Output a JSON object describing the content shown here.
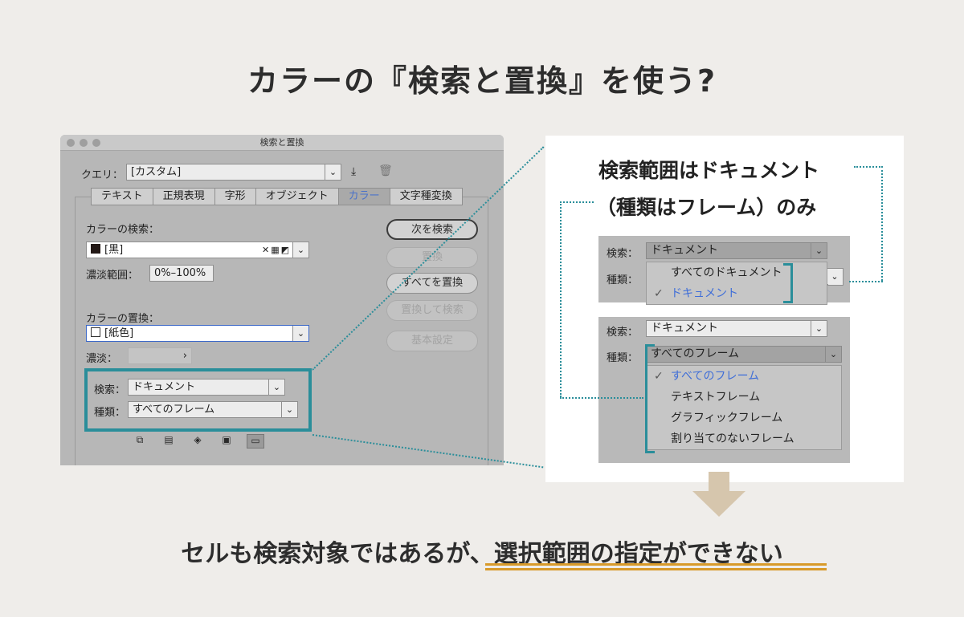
{
  "title": "カラーの『検索と置換』を使う?",
  "dialog": {
    "window_title": "検索と置換",
    "query_label": "クエリ：",
    "query_value": "[カスタム]",
    "tabs": [
      "テキスト",
      "正規表現",
      "字形",
      "オブジェクト",
      "カラー",
      "文字種変換"
    ],
    "active_tab": "カラー",
    "find_color_label": "カラーの検索：",
    "find_color_value": "[黒]",
    "tint_range_label": "濃淡範囲：",
    "tint_range_value": "0%–100%",
    "replace_color_label": "カラーの置換：",
    "replace_color_value": "[紙色]",
    "tint_label": "濃淡：",
    "search_label": "検索：",
    "search_value": "ドキュメント",
    "type_label": "種類：",
    "type_value": "すべてのフレーム",
    "buttons": {
      "find_next": "次を検索",
      "replace": "置換",
      "replace_all": "すべてを置換",
      "replace_find": "置換して検索",
      "basic": "基本設定"
    }
  },
  "panel": {
    "heading_line1": "検索範囲はドキュメント",
    "heading_line2": "（種類はフレーム）のみ",
    "search_label": "検索：",
    "search_value": "ドキュメント",
    "type_label": "種類：",
    "scope_menu": [
      "すべてのドキュメント",
      "ドキュメント"
    ],
    "scope_checked": "ドキュメント",
    "type_value": "すべてのフレーム",
    "type_menu": [
      "すべてのフレーム",
      "テキストフレーム",
      "グラフィックフレーム",
      "割り当てのないフレーム"
    ],
    "type_checked": "すべてのフレーム"
  },
  "conclusion": {
    "part1": "セルも検索対象ではあるが、",
    "part2": "選択範囲の指定ができない"
  },
  "colors": {
    "accent_teal": "#2a8e9a",
    "selected_blue": "#3f6ed8",
    "underline_gold": "#d89a2a",
    "arrow_beige": "#d6c6ad"
  }
}
